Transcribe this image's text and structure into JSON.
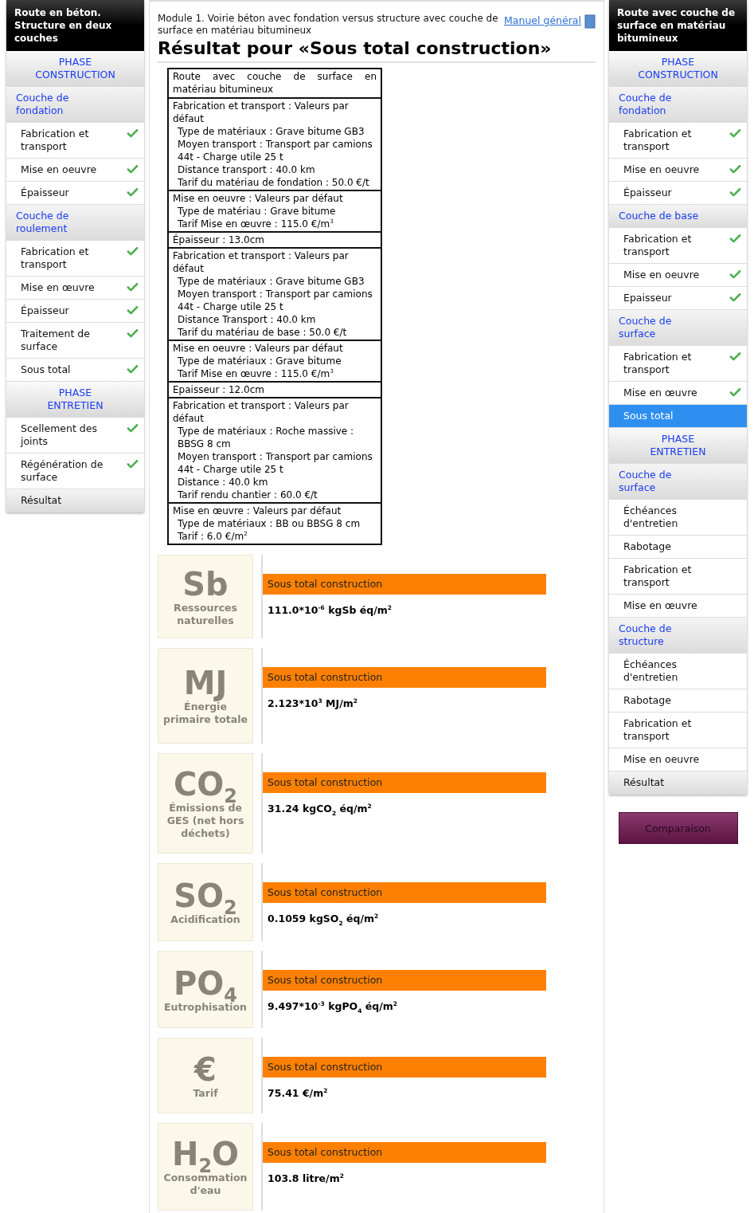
{
  "left_nav": {
    "title": "Route en béton. Structure en deux couches",
    "items": [
      {
        "kind": "phase",
        "label": "PHASE CONSTRUCTION",
        "selected": false
      },
      {
        "kind": "section",
        "label": "Couche de fondation",
        "selected": false
      },
      {
        "kind": "step",
        "label": "Fabrication et transport",
        "checked": true,
        "selected": false
      },
      {
        "kind": "step",
        "label": "Mise en oeuvre",
        "checked": true,
        "selected": false
      },
      {
        "kind": "step",
        "label": "Épaisseur",
        "checked": true,
        "selected": false
      },
      {
        "kind": "section",
        "label": "Couche de roulement",
        "selected": false
      },
      {
        "kind": "step",
        "label": "Fabrication et transport",
        "checked": true,
        "selected": false
      },
      {
        "kind": "step",
        "label": "Mise en œuvre",
        "checked": true,
        "selected": false
      },
      {
        "kind": "step",
        "label": "Épaisseur",
        "checked": true,
        "selected": false
      },
      {
        "kind": "step",
        "label": "Traitement de surface",
        "checked": true,
        "selected": false
      },
      {
        "kind": "step",
        "label": "Sous total",
        "checked": true,
        "selected": false
      },
      {
        "kind": "phase",
        "label": "PHASE ENTRETIEN",
        "selected": false
      },
      {
        "kind": "step",
        "label": "Scellement des joints",
        "checked": true,
        "selected": false
      },
      {
        "kind": "step",
        "label": "Régénération de surface",
        "checked": true,
        "selected": false
      },
      {
        "kind": "result",
        "label": "Résultat",
        "selected": false
      }
    ]
  },
  "main": {
    "module": "Module 1. Voirie béton avec fondation versus structure avec couche de surface en matériau bitumineux",
    "manual_link": "Manuel général",
    "title": "Résultat pour «Sous total construction»",
    "summary_table": {
      "heading": "Route avec couche de surface en matériau bitumineux",
      "blocks": [
        {
          "lines": [
            "Fabrication et transport : Valeurs par défaut",
            "Type de matériaux : Grave bitume GB3",
            "Moyen transport : Transport par camions 44t - Charge utile 25 t",
            "Distance transport : 40.0 km",
            "Tarif du matériau de fondation : 50.0 €/t"
          ]
        },
        {
          "lines": [
            "Mise en oeuvre : Valeurs par défaut",
            "Type de matériau : Grave bitume",
            "Tarif Mise en œuvre : 115.0 €/m$^{3}$"
          ]
        },
        {
          "lines": [
            "Épaisseur : 13.0cm"
          ]
        },
        {
          "lines": [
            "Fabrication et transport : Valeurs par défaut",
            "Type de matériaux : Grave bitume GB3",
            "Moyen transport : Transport par camions 44t - Charge utile 25 t",
            "Distance Transport : 40.0 km",
            "Tarif du matériau de base : 50.0 €/t"
          ]
        },
        {
          "lines": [
            "Mise en oeuvre : Valeurs par défaut",
            "Type de matériaux : Grave bitume",
            "Tarif Mise en œuvre : 115.0 €/m$^{3}$"
          ]
        },
        {
          "lines": [
            "Epaisseur : 12.0cm"
          ]
        },
        {
          "lines": [
            "Fabrication et transport : Valeurs par défaut",
            "Type de matériaux : Roche massive : BBSG 8 cm",
            "Moyen transport : Transport par camions 44t - Charge utile 25 t",
            "Distance : 40.0 km",
            "Tarif rendu chantier : 60.0 €/t"
          ]
        },
        {
          "lines": [
            "Mise en œuvre : Valeurs par défaut",
            "Type de matériaux : BB ou BBSG 8 cm",
            "Tarif : 6.0 €/m$^{2}$"
          ]
        }
      ]
    },
    "indicators": [
      {
        "symbol": "Sb",
        "label": "Ressources naturelles",
        "bar_label": "Sous total construction",
        "value": "111.0*10$^{-6}$ kgSb éq/m$^{2}$"
      },
      {
        "symbol": "MJ",
        "label": "Énergie primaire totale",
        "bar_label": "Sous total construction",
        "value": "2.123*10$^{3}$ MJ/m$^{2}$"
      },
      {
        "symbol": "CO$_{2}$",
        "label": "Émissions de GES (net hors déchets)",
        "bar_label": "Sous total construction",
        "value": "31.24 kgCO$_{2}$ éq/m$^{2}$"
      },
      {
        "symbol": "SO$_{2}$",
        "label": "Acidification",
        "bar_label": "Sous total construction",
        "value": "0.1059 kgSO$_{2}$ éq/m$^{2}$"
      },
      {
        "symbol": "PO$_{4}$",
        "label": "Eutrophisation",
        "bar_label": "Sous total construction",
        "value": "9.497*10$^{-3}$ kgPO$_{4}$ éq/m$^{2}$"
      },
      {
        "symbol": "€",
        "label": "Tarif",
        "bar_label": "Sous total construction",
        "value": "75.41 €/m$^{2}$"
      },
      {
        "symbol": "H$_{2}$O",
        "label": "Consommation d'eau",
        "bar_label": "Sous total construction",
        "value": "103.8 litre/m$^{2}$"
      }
    ]
  },
  "right_nav": {
    "title": "Route avec couche de surface en matériau bitumineux",
    "items": [
      {
        "kind": "phase",
        "label": "PHASE CONSTRUCTION",
        "selected": false
      },
      {
        "kind": "section",
        "label": "Couche de fondation",
        "selected": false
      },
      {
        "kind": "step",
        "label": "Fabrication et transport",
        "checked": true,
        "selected": false
      },
      {
        "kind": "step",
        "label": "Mise en oeuvre",
        "checked": true,
        "selected": false
      },
      {
        "kind": "step",
        "label": "Épaisseur",
        "checked": true,
        "selected": false
      },
      {
        "kind": "section",
        "label": "Couche de base",
        "selected": false
      },
      {
        "kind": "step",
        "label": "Fabrication et transport",
        "checked": true,
        "selected": false
      },
      {
        "kind": "step",
        "label": "Mise en oeuvre",
        "checked": true,
        "selected": false
      },
      {
        "kind": "step",
        "label": "Epaisseur",
        "checked": true,
        "selected": false
      },
      {
        "kind": "section",
        "label": "Couche de surface",
        "selected": false
      },
      {
        "kind": "step",
        "label": "Fabrication et transport",
        "checked": true,
        "selected": false
      },
      {
        "kind": "step",
        "label": "Mise en œuvre",
        "checked": true,
        "selected": false
      },
      {
        "kind": "step",
        "label": "Sous total",
        "checked": false,
        "selected": true
      },
      {
        "kind": "phase",
        "label": "PHASE ENTRETIEN",
        "selected": false
      },
      {
        "kind": "section",
        "label": "Couche de surface",
        "selected": false
      },
      {
        "kind": "step",
        "label": "Échéances d'entretien",
        "checked": false,
        "selected": false
      },
      {
        "kind": "step",
        "label": "Rabotage",
        "checked": false,
        "selected": false
      },
      {
        "kind": "step",
        "label": "Fabrication et transport",
        "checked": false,
        "selected": false
      },
      {
        "kind": "step",
        "label": "Mise en œuvre",
        "checked": false,
        "selected": false
      },
      {
        "kind": "section",
        "label": "Couche de structure",
        "selected": false
      },
      {
        "kind": "step",
        "label": "Échéances d'entretien",
        "checked": false,
        "selected": false
      },
      {
        "kind": "step",
        "label": "Rabotage",
        "checked": false,
        "selected": false
      },
      {
        "kind": "step",
        "label": "Fabrication et transport",
        "checked": false,
        "selected": false
      },
      {
        "kind": "step",
        "label": "Mise en oeuvre",
        "checked": false,
        "selected": false
      },
      {
        "kind": "result",
        "label": "Résultat",
        "selected": false
      }
    ],
    "button": "Comparaison"
  }
}
